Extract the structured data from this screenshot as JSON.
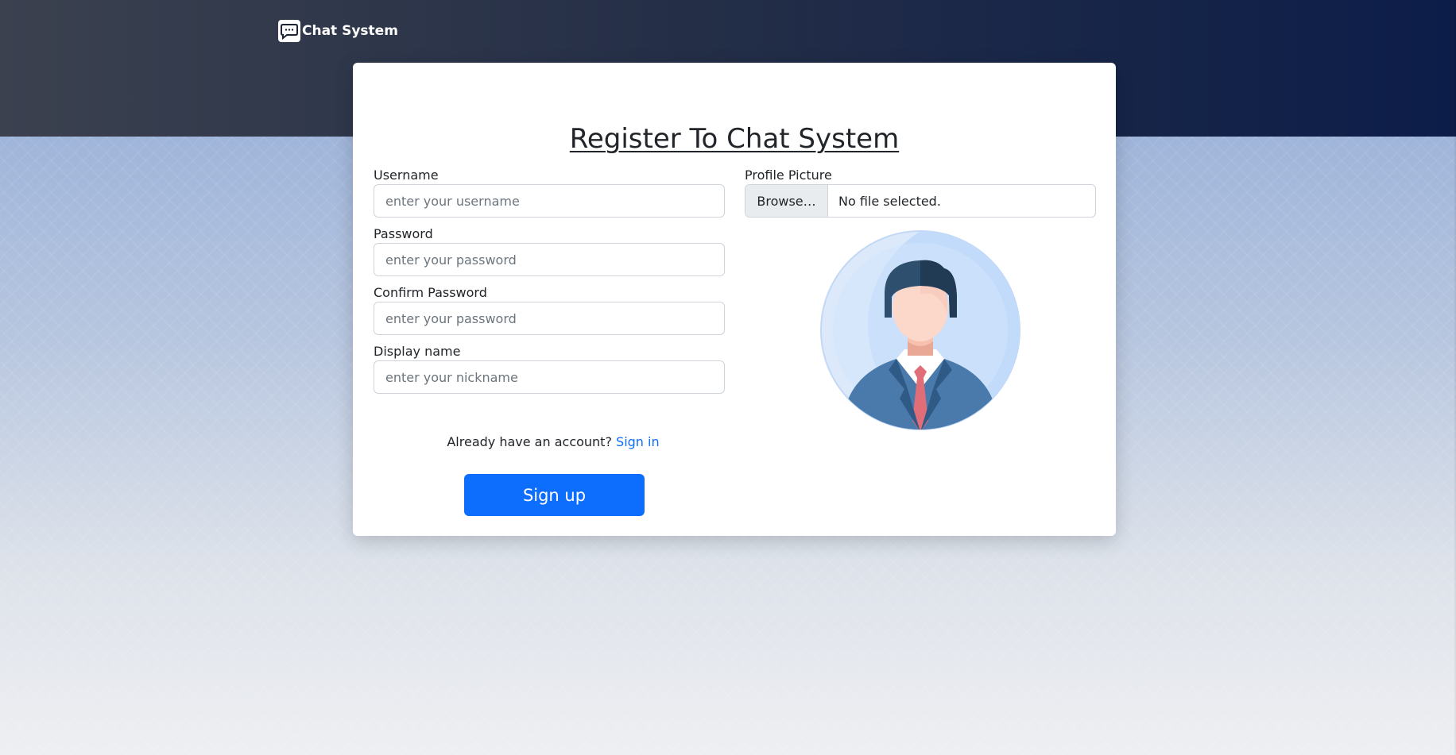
{
  "app": {
    "brand": "Chat System",
    "brand_icon": "chat-bubble-icon"
  },
  "card": {
    "title": "Register To Chat System",
    "fields": [
      {
        "label": "Username",
        "placeholder": "enter your username",
        "type": "text"
      },
      {
        "label": "Password",
        "placeholder": "enter your password",
        "type": "password"
      },
      {
        "label": "Confirm Password",
        "placeholder": "enter your password",
        "type": "password"
      },
      {
        "label": "Display name",
        "placeholder": "enter your nickname",
        "type": "text"
      }
    ],
    "profile_picture": {
      "label": "Profile Picture",
      "browse_label": "Browse…",
      "file_status": "No file selected.",
      "avatar_icon": "default-avatar-icon"
    },
    "account_prompt": "Already have an account?",
    "signin_link": "Sign in",
    "signup_button": "Sign up"
  },
  "colors": {
    "primary": "#0d6efd",
    "topbar_start": "#3b414f",
    "topbar_end": "#0c1d49",
    "suit": "#4a7aab",
    "tie": "#e06d78",
    "avatar_bg": "#c6dcf8"
  }
}
